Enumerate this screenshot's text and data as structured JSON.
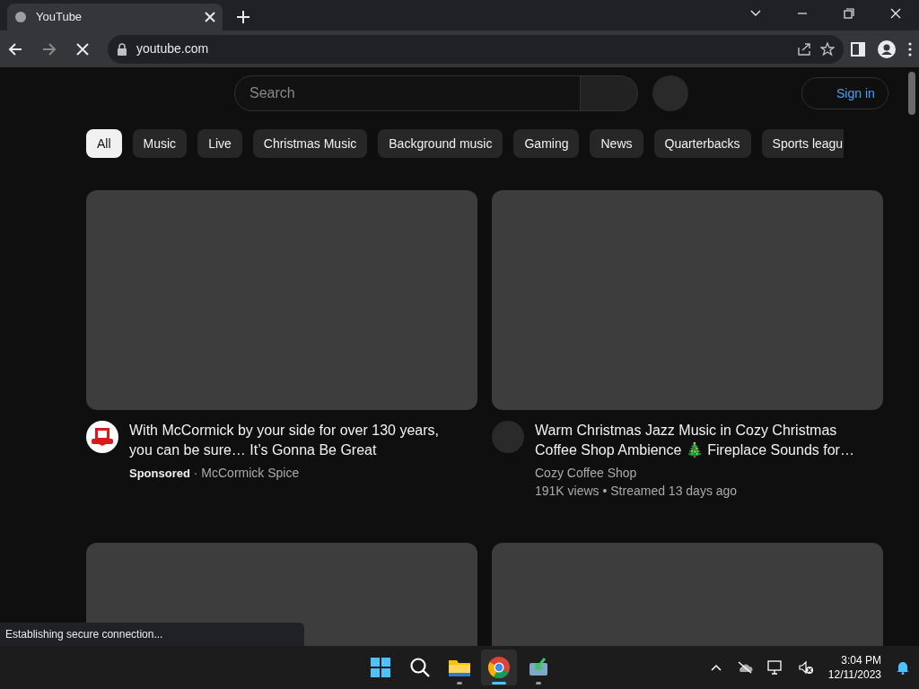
{
  "browser": {
    "tab_title": "YouTube",
    "address": "youtube.com",
    "loading": true,
    "status": "Establishing secure connection..."
  },
  "page": {
    "search": {
      "placeholder": "Search"
    },
    "sign_in": "Sign in",
    "chips": [
      {
        "label": "All",
        "selected": true
      },
      {
        "label": "Music",
        "selected": false
      },
      {
        "label": "Live",
        "selected": false
      },
      {
        "label": "Christmas Music",
        "selected": false
      },
      {
        "label": "Background music",
        "selected": false
      },
      {
        "label": "Gaming",
        "selected": false
      },
      {
        "label": "News",
        "selected": false
      },
      {
        "label": "Quarterbacks",
        "selected": false
      },
      {
        "label": "Sports leagu",
        "selected": false
      }
    ],
    "videos": [
      {
        "kind": "video",
        "avatar": {
          "kind": "logo"
        },
        "title": "With McCormick by your side for over 130 years, you can be sure… It’s Gonna Be Great",
        "meta": [
          "**Sponsored** · McCormick Spice"
        ]
      },
      {
        "kind": "video",
        "avatar": {
          "kind": "loading"
        },
        "title": "Warm Christmas Jazz Music in Cozy Christmas Coffee Shop Ambience 🎄 Fireplace Sounds for…",
        "meta": [
          "Cozy Coffee Shop",
          "191K views • Streamed 13 days ago"
        ]
      },
      {
        "kind": "loading"
      },
      {
        "kind": "loading"
      }
    ]
  },
  "taskbar": {
    "apps": [
      {
        "kind": "start",
        "running": false,
        "selected": false
      },
      {
        "kind": "search",
        "running": false,
        "selected": false
      },
      {
        "kind": "folder",
        "running": true,
        "selected": false
      },
      {
        "kind": "browser",
        "running": true,
        "selected": true
      },
      {
        "kind": "download",
        "running": true,
        "selected": false
      }
    ],
    "time": "3:04 PM",
    "date": "12/11/2023"
  }
}
